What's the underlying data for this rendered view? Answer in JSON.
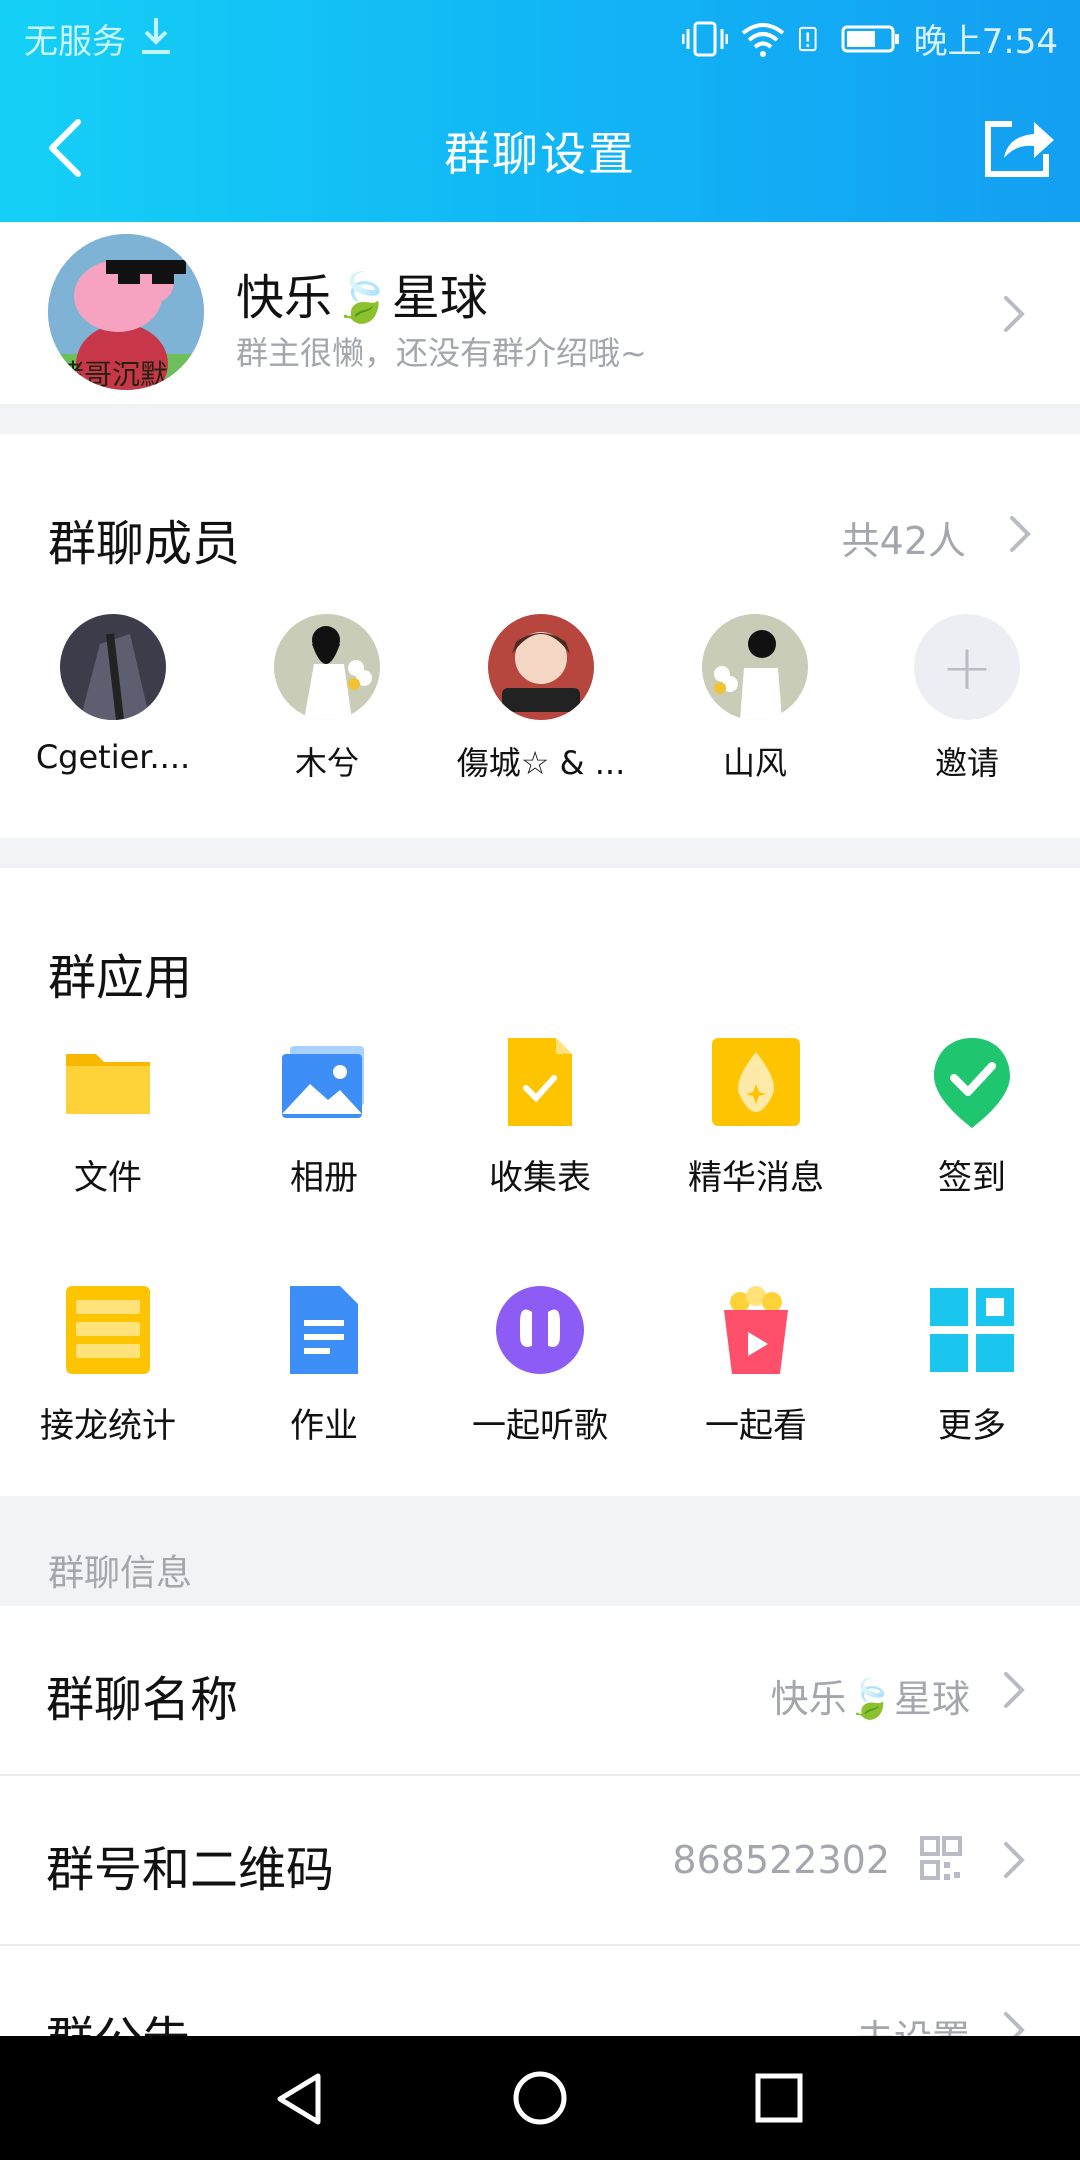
{
  "status_bar": {
    "carrier": "无服务",
    "time": "晚上7:54"
  },
  "header": {
    "title": "群聊设置"
  },
  "group": {
    "name": "快乐🍃星球",
    "description": "群主很懒，还没有群介绍哦~",
    "avatar_caption": "猪哥沉默"
  },
  "members": {
    "title": "群聊成员",
    "count": "共42人",
    "items": [
      {
        "label": "Cgetier...."
      },
      {
        "label": "木兮"
      },
      {
        "label": "傷城☆ & ..."
      },
      {
        "label": "山风"
      },
      {
        "label": "邀请"
      }
    ]
  },
  "apps": {
    "title": "群应用",
    "items": [
      {
        "label": "文件",
        "icon": "folder-icon"
      },
      {
        "label": "相册",
        "icon": "album-icon"
      },
      {
        "label": "收集表",
        "icon": "form-icon"
      },
      {
        "label": "精华消息",
        "icon": "essence-icon"
      },
      {
        "label": "签到",
        "icon": "check-in-icon"
      },
      {
        "label": "接龙统计",
        "icon": "solitaire-icon"
      },
      {
        "label": "作业",
        "icon": "homework-icon"
      },
      {
        "label": "一起听歌",
        "icon": "headphones-icon"
      },
      {
        "label": "一起看",
        "icon": "popcorn-icon"
      },
      {
        "label": "更多",
        "icon": "more-grid-icon"
      }
    ]
  },
  "info": {
    "header": "群聊信息",
    "rows": [
      {
        "key": "群聊名称",
        "value": "快乐🍃星球"
      },
      {
        "key": "群号和二维码",
        "value": "868522302"
      },
      {
        "key": "群公告",
        "value": "未设置"
      }
    ]
  },
  "colors": {
    "header_start": "#14d0f6",
    "header_end": "#139ff2",
    "background": "#f2f3f7",
    "secondary_text": "#a3a6ad"
  }
}
